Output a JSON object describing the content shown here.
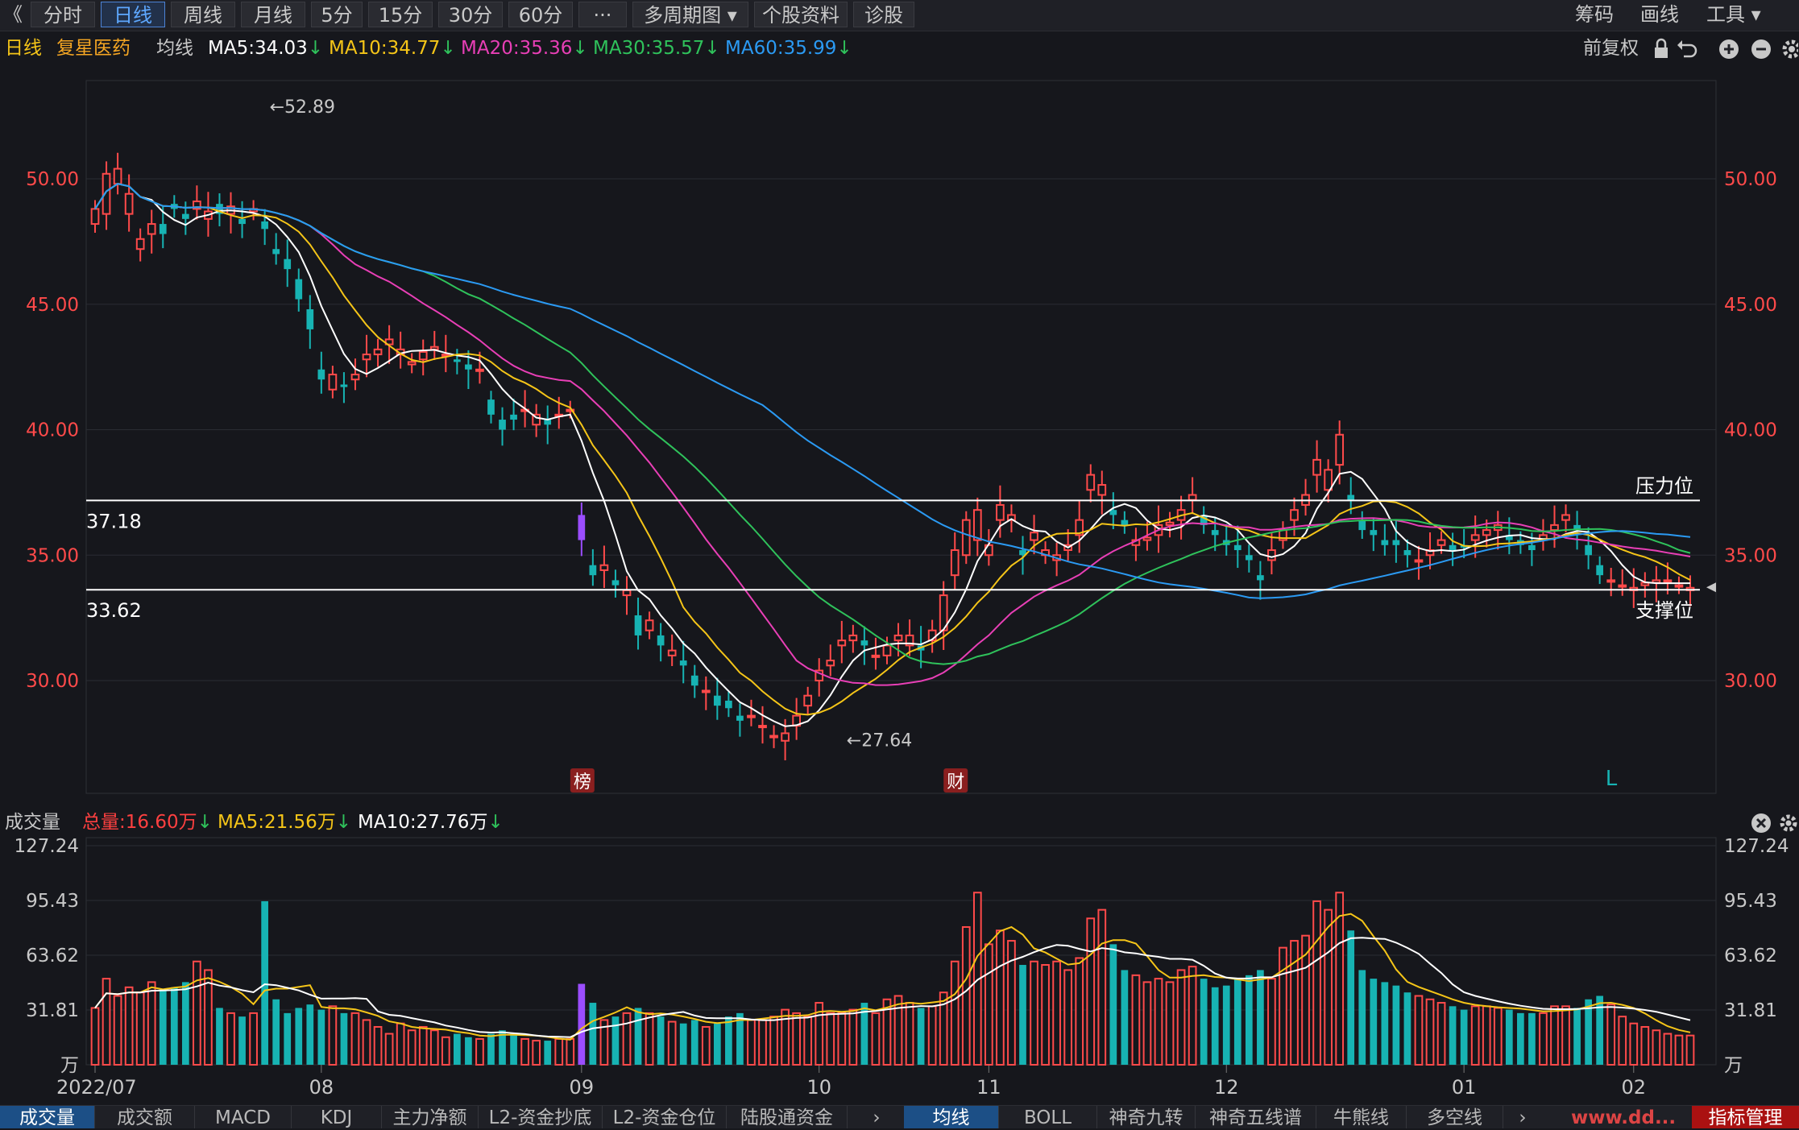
{
  "toolbar": {
    "back_glyph": "《",
    "tabs": [
      "分时",
      "日线",
      "周线",
      "月线",
      "5分",
      "15分",
      "30分",
      "60分",
      "···",
      "多周期图 ▾",
      "个股资料",
      "诊股"
    ],
    "active_tab": "日线",
    "right_items": [
      "筹码",
      "画线",
      "工具 ▾"
    ]
  },
  "subbar": {
    "period": "日线",
    "stock_name": "复星医药",
    "ma_label": "均线",
    "ma_items": [
      {
        "text": "MA5:34.03",
        "color": "#ffffff"
      },
      {
        "text": "MA10:34.77",
        "color": "#f5c518"
      },
      {
        "text": "MA20:35.36",
        "color": "#e83fb6"
      },
      {
        "text": "MA30:35.57",
        "color": "#2fc25b"
      },
      {
        "text": "MA60:35.99",
        "color": "#2b9af3"
      }
    ],
    "adjust": "前复权"
  },
  "volume_bar": {
    "label": "成交量",
    "items": [
      {
        "text": "总量:16.60万",
        "color": "#ff4040"
      },
      {
        "text": "MA5:21.56万",
        "color": "#f5c518"
      },
      {
        "text": "MA10:27.76万",
        "color": "#ffffff"
      }
    ]
  },
  "colors": {
    "up": "#ff4a4a",
    "down": "#17b3b3",
    "ma5": "#ffffff",
    "ma10": "#f5c518",
    "ma20": "#e83fb6",
    "ma30": "#2fc25b",
    "ma60": "#2b9af3"
  },
  "chart_data": {
    "type": "candlestick",
    "price_axis": {
      "ylim": [
        26.0,
        53.5
      ],
      "ticks": [
        "30.00",
        "35.00",
        "40.00",
        "45.00",
        "50.00"
      ]
    },
    "volume_axis": {
      "ylim": [
        0,
        127.24
      ],
      "ticks": [
        "31.81",
        "63.62",
        "95.43",
        "127.24"
      ],
      "unit": "万"
    },
    "x_labels": [
      {
        "label": "2022/07",
        "index": 0
      },
      {
        "label": "08",
        "index": 20
      },
      {
        "label": "09",
        "index": 43
      },
      {
        "label": "10",
        "index": 64
      },
      {
        "label": "11",
        "index": 79
      },
      {
        "label": "12",
        "index": 100
      },
      {
        "label": "01",
        "index": 121
      },
      {
        "label": "02",
        "index": 136
      }
    ],
    "markers": {
      "high": {
        "value": "52.89",
        "index": 15
      },
      "low": {
        "value": "27.64",
        "index": 66
      }
    },
    "lines": [
      {
        "name": "压力位",
        "value": 37.18,
        "label": "37.18"
      },
      {
        "name": "支撑位",
        "value": 33.62,
        "label": "33.62"
      }
    ],
    "badges": [
      {
        "text": "榜",
        "index": 43
      },
      {
        "text": "财",
        "index": 76
      }
    ],
    "end_marker": "L",
    "anchors": [
      [
        0,
        48.2,
        48.8,
        33
      ],
      [
        1,
        48.6,
        50.2,
        50
      ],
      [
        2,
        49.8,
        50.4,
        40
      ],
      [
        3,
        48.6,
        49.4,
        45
      ],
      [
        4,
        47.2,
        47.6,
        42
      ],
      [
        5,
        47.8,
        48.2,
        48
      ],
      [
        6,
        48.2,
        47.8,
        44
      ],
      [
        7,
        49.0,
        48.8,
        45
      ],
      [
        8,
        48.6,
        48.4,
        48
      ],
      [
        9,
        48.8,
        49.1,
        60
      ],
      [
        10,
        48.4,
        48.7,
        55
      ],
      [
        11,
        49.0,
        48.6,
        33
      ],
      [
        12,
        48.6,
        48.9,
        30
      ],
      [
        13,
        48.4,
        48.2,
        28
      ],
      [
        14,
        48.7,
        48.8,
        30
      ],
      [
        15,
        48.3,
        48.0,
        95
      ],
      [
        16,
        47.2,
        47.0,
        38
      ],
      [
        17,
        46.8,
        46.4,
        30
      ],
      [
        18,
        46.0,
        45.2,
        33
      ],
      [
        19,
        44.8,
        44.0,
        35
      ],
      [
        20,
        42.4,
        42.0,
        32
      ],
      [
        21,
        41.6,
        42.2,
        34
      ],
      [
        22,
        41.8,
        41.7,
        30
      ],
      [
        23,
        42.0,
        42.2,
        30
      ],
      [
        24,
        42.8,
        43.0,
        26
      ],
      [
        25,
        43.0,
        43.2,
        22
      ],
      [
        26,
        43.4,
        43.6,
        18
      ],
      [
        27,
        43.0,
        43.2,
        24
      ],
      [
        28,
        42.6,
        42.7,
        20
      ],
      [
        29,
        42.8,
        43.1,
        22
      ],
      [
        30,
        43.2,
        43.3,
        20
      ],
      [
        31,
        43.0,
        43.0,
        16
      ],
      [
        32,
        42.8,
        42.7,
        18
      ],
      [
        33,
        42.6,
        42.4,
        16
      ],
      [
        34,
        42.4,
        42.4,
        15
      ],
      [
        35,
        41.2,
        40.6,
        18
      ],
      [
        36,
        40.4,
        40.0,
        20
      ],
      [
        37,
        40.6,
        40.4,
        18
      ],
      [
        38,
        40.8,
        40.8,
        15
      ],
      [
        39,
        40.2,
        40.6,
        14
      ],
      [
        40,
        40.4,
        40.2,
        14
      ],
      [
        41,
        40.6,
        40.6,
        15
      ],
      [
        42,
        40.8,
        40.8,
        15
      ],
      [
        43,
        36.6,
        35.6,
        47
      ],
      [
        44,
        34.6,
        34.2,
        36
      ],
      [
        45,
        34.4,
        34.6,
        26
      ],
      [
        46,
        34.0,
        33.8,
        28
      ],
      [
        47,
        33.4,
        33.6,
        30
      ],
      [
        48,
        32.6,
        31.8,
        33
      ],
      [
        49,
        32.0,
        32.4,
        30
      ],
      [
        50,
        31.8,
        31.4,
        28
      ],
      [
        51,
        31.0,
        31.2,
        25
      ],
      [
        52,
        30.8,
        30.6,
        24
      ],
      [
        53,
        30.2,
        29.8,
        26
      ],
      [
        54,
        29.6,
        29.6,
        22
      ],
      [
        55,
        29.4,
        29.0,
        24
      ],
      [
        56,
        29.2,
        28.9,
        28
      ],
      [
        57,
        28.6,
        28.4,
        30
      ],
      [
        58,
        28.6,
        28.6,
        26
      ],
      [
        59,
        28.2,
        28.2,
        26
      ],
      [
        60,
        27.8,
        27.8,
        28
      ],
      [
        61,
        27.6,
        27.9,
        32
      ],
      [
        62,
        28.2,
        28.6,
        30
      ],
      [
        63,
        29.0,
        29.4,
        28
      ],
      [
        64,
        30.0,
        30.4,
        36
      ],
      [
        65,
        30.6,
        30.8,
        30
      ],
      [
        66,
        31.4,
        31.6,
        30
      ],
      [
        67,
        31.6,
        31.8,
        32
      ],
      [
        68,
        31.6,
        31.4,
        36
      ],
      [
        69,
        31.0,
        31.0,
        30
      ],
      [
        70,
        31.0,
        31.4,
        38
      ],
      [
        71,
        31.6,
        31.8,
        40
      ],
      [
        72,
        31.4,
        31.8,
        36
      ],
      [
        73,
        31.4,
        31.2,
        33
      ],
      [
        74,
        31.6,
        32.0,
        34
      ],
      [
        75,
        32.0,
        33.4,
        42
      ],
      [
        76,
        34.2,
        35.2,
        60
      ],
      [
        77,
        35.0,
        36.4,
        80
      ],
      [
        78,
        35.6,
        36.8,
        100
      ],
      [
        79,
        35.0,
        35.4,
        70
      ],
      [
        80,
        36.4,
        37.0,
        78
      ],
      [
        81,
        36.4,
        36.6,
        72
      ],
      [
        82,
        35.2,
        35.0,
        58
      ],
      [
        83,
        35.6,
        35.9,
        60
      ],
      [
        84,
        35.0,
        35.2,
        58
      ],
      [
        85,
        34.8,
        35.0,
        60
      ],
      [
        86,
        35.2,
        35.4,
        55
      ],
      [
        87,
        35.8,
        36.4,
        62
      ],
      [
        88,
        37.6,
        38.2,
        85
      ],
      [
        89,
        37.4,
        37.8,
        90
      ],
      [
        90,
        36.8,
        36.6,
        70
      ],
      [
        91,
        36.4,
        36.2,
        55
      ],
      [
        92,
        35.4,
        35.6,
        52
      ],
      [
        93,
        35.6,
        35.7,
        48
      ],
      [
        94,
        35.8,
        36.2,
        50
      ],
      [
        95,
        36.2,
        36.3,
        48
      ],
      [
        96,
        36.4,
        36.8,
        55
      ],
      [
        97,
        37.2,
        37.4,
        57
      ],
      [
        98,
        36.6,
        36.2,
        50
      ],
      [
        99,
        36.0,
        35.8,
        45
      ],
      [
        100,
        35.6,
        35.4,
        46
      ],
      [
        101,
        35.4,
        35.2,
        50
      ],
      [
        102,
        35.0,
        34.8,
        52
      ],
      [
        103,
        34.2,
        34.0,
        55
      ],
      [
        104,
        34.8,
        35.2,
        50
      ],
      [
        105,
        35.6,
        36.0,
        68
      ],
      [
        106,
        36.4,
        36.8,
        72
      ],
      [
        107,
        37.0,
        37.4,
        75
      ],
      [
        108,
        38.2,
        38.8,
        95
      ],
      [
        109,
        37.6,
        38.4,
        90
      ],
      [
        110,
        38.6,
        39.8,
        100
      ],
      [
        111,
        37.4,
        37.2,
        78
      ],
      [
        112,
        36.4,
        36.0,
        55
      ],
      [
        113,
        36.0,
        35.8,
        50
      ],
      [
        114,
        35.6,
        35.4,
        48
      ],
      [
        115,
        35.6,
        35.4,
        46
      ],
      [
        116,
        35.2,
        35.0,
        42
      ],
      [
        117,
        34.8,
        34.8,
        40
      ],
      [
        118,
        35.0,
        35.2,
        38
      ],
      [
        119,
        35.4,
        35.6,
        36
      ],
      [
        120,
        35.4,
        35.2,
        34
      ],
      [
        121,
        35.4,
        35.3,
        32
      ],
      [
        122,
        35.6,
        35.8,
        34
      ],
      [
        123,
        35.8,
        36.0,
        34
      ],
      [
        124,
        36.0,
        36.2,
        33
      ],
      [
        125,
        35.8,
        35.6,
        32
      ],
      [
        126,
        35.6,
        35.4,
        30
      ],
      [
        127,
        35.4,
        35.2,
        30
      ],
      [
        128,
        35.6,
        35.8,
        30
      ],
      [
        129,
        36.0,
        36.2,
        34
      ],
      [
        130,
        36.4,
        36.6,
        34
      ],
      [
        131,
        36.2,
        36.0,
        33
      ],
      [
        132,
        35.4,
        35.0,
        38
      ],
      [
        133,
        34.6,
        34.2,
        40
      ],
      [
        134,
        34.0,
        34.0,
        35
      ],
      [
        135,
        33.8,
        33.8,
        28
      ],
      [
        136,
        33.6,
        33.7,
        24
      ],
      [
        137,
        33.8,
        33.9,
        22
      ],
      [
        138,
        33.9,
        34.0,
        20
      ],
      [
        139,
        34.0,
        34.0,
        18
      ],
      [
        140,
        33.8,
        33.8,
        17
      ],
      [
        141,
        33.6,
        33.7,
        17
      ]
    ]
  },
  "bottom_tabs": {
    "left": [
      "成交量",
      "成交额",
      "MACD",
      "KDJ",
      "主力净额",
      "L2-资金抄底",
      "L2-资金仓位",
      "陆股通资金"
    ],
    "right": [
      "均线",
      "BOLL",
      "神奇九转",
      "神奇五线谱",
      "牛熊线",
      "多空线"
    ],
    "manage": "指标管理",
    "watermark": "www.dd..."
  }
}
